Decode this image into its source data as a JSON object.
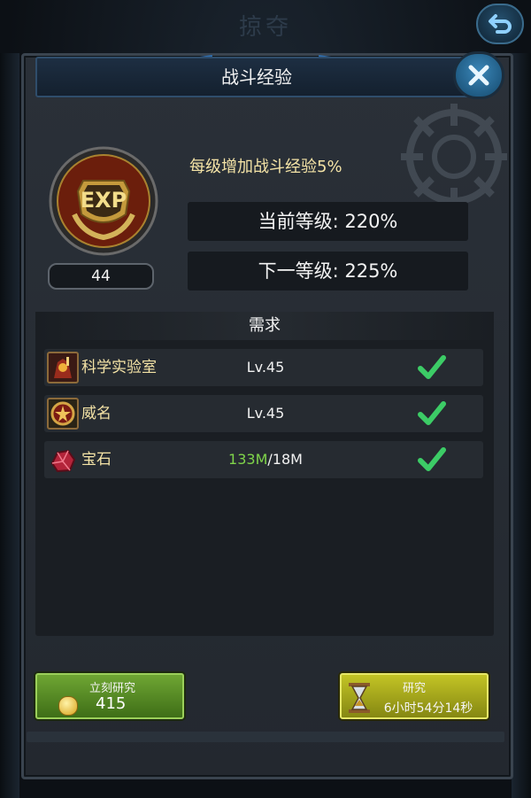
{
  "background_title": "掠夺",
  "dialog": {
    "title": "战斗经验",
    "level": "44",
    "description": "每级增加战斗经验5%",
    "current_level_text": "当前等级: 220%",
    "next_level_text": "下一等级: 225%"
  },
  "requirements": {
    "title": "需求",
    "items": [
      {
        "name": "科学实验室",
        "value": "Lv.45",
        "met": true,
        "icon": "science-lab-icon"
      },
      {
        "name": "威名",
        "value": "Lv.45",
        "met": true,
        "icon": "prestige-icon"
      },
      {
        "name": "宝石",
        "have": "133M",
        "need": "/18M",
        "met": true,
        "icon": "gem-icon"
      }
    ]
  },
  "buttons": {
    "instant": {
      "label": "立刻研究",
      "cost": "415"
    },
    "research": {
      "label": "研究",
      "time": "6小时54分14秒"
    }
  },
  "badge_text": "EXP",
  "colors": {
    "gold_text": "#f4e3a6",
    "have_amount": "#7fd44a",
    "check": "#3ccc66",
    "instant_button": "#5a8f28",
    "research_button": "#b0b21e"
  }
}
